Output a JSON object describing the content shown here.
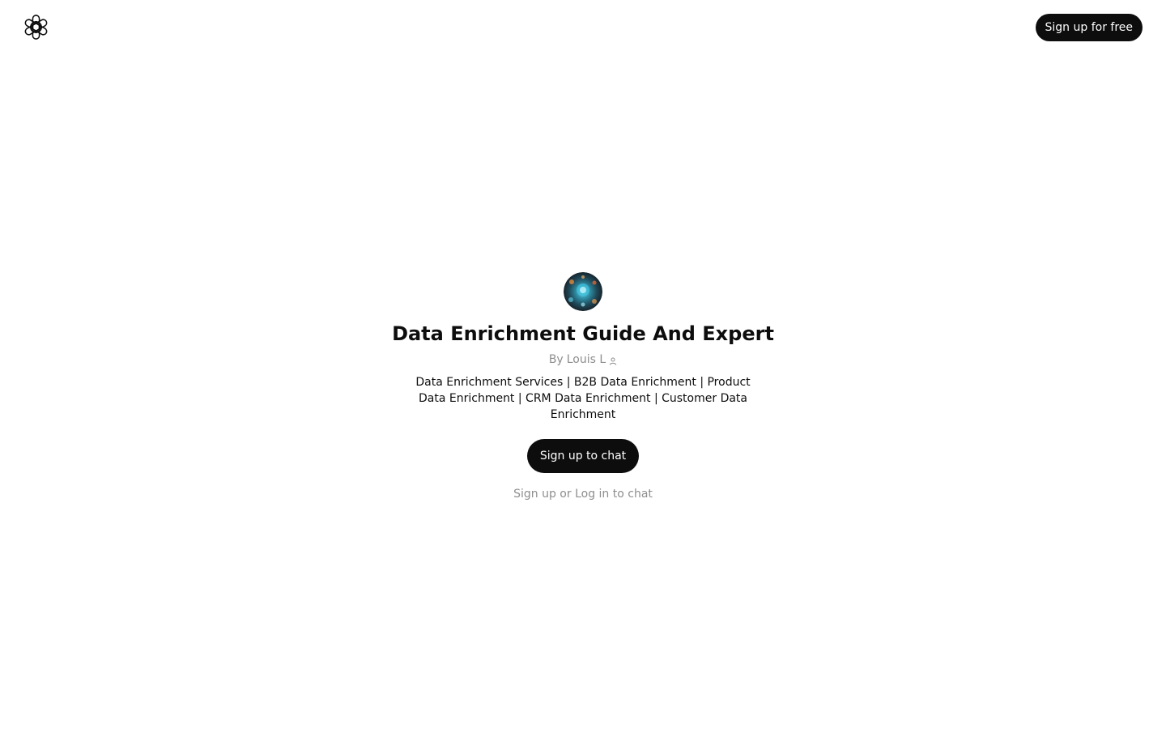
{
  "header": {
    "logo_icon": "openai-logo-icon",
    "signup_label": "Sign up for free"
  },
  "gpt": {
    "title": "Data Enrichment Guide And Expert",
    "author_prefix": "By",
    "author_name": "Louis L",
    "author_icon": "person-icon",
    "description": "Data Enrichment Services | B2B Data Enrichment | Product Data Enrichment | CRM Data Enrichment | Customer Data Enrichment"
  },
  "actions": {
    "chat_button_label": "Sign up to chat",
    "signup_link": "Sign up",
    "or_text": "or",
    "login_link": "Log in",
    "to_chat_text": "to chat"
  },
  "colors": {
    "button_bg": "#0d0d0d",
    "muted_text": "#8e8e8e"
  }
}
